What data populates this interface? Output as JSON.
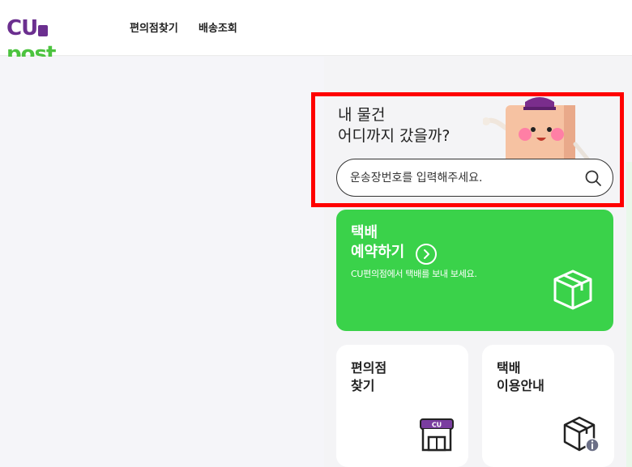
{
  "header": {
    "logo": {
      "part1": "CU",
      "part2": "post"
    },
    "nav": [
      "편의점찾기",
      "배송조회"
    ]
  },
  "tracking": {
    "title_line1": "내 물건",
    "title_line2": "어디까지 갔을까?",
    "placeholder": "운송장번호를 입력해주세요."
  },
  "reserve_card": {
    "title_line1": "택배",
    "title_line2": "예약하기",
    "subtitle": "CU편의점에서 택배를 보내 보세요."
  },
  "cards": [
    {
      "line1": "편의점",
      "line2": "찾기"
    },
    {
      "line1": "택배",
      "line2": "이용안내"
    }
  ],
  "colors": {
    "accent_purple": "#6b2f8f",
    "accent_green": "#3ad24a",
    "highlight_red": "#ff0000"
  }
}
